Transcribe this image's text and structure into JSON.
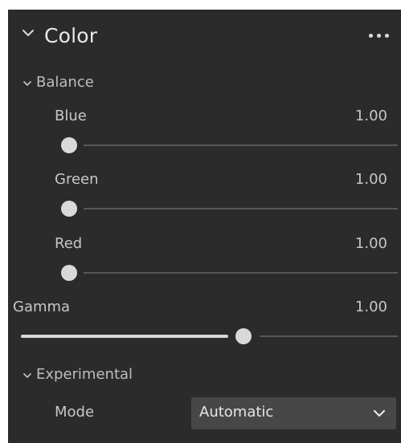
{
  "panel": {
    "title": "Color",
    "more_icon": "more-horizontal-icon"
  },
  "balance": {
    "label": "Balance",
    "sliders": [
      {
        "label": "Blue",
        "value": "1.00",
        "position": 0.0
      },
      {
        "label": "Green",
        "value": "1.00",
        "position": 0.0
      },
      {
        "label": "Red",
        "value": "1.00",
        "position": 0.0
      }
    ]
  },
  "gamma": {
    "label": "Gamma",
    "value": "1.00",
    "position": 0.59
  },
  "experimental": {
    "label": "Experimental",
    "mode_label": "Mode",
    "mode_value": "Automatic"
  },
  "colors": {
    "panel_bg": "#2b2b2b",
    "text": "#c7c7c7",
    "track": "#575757",
    "thumb": "#d9d9d9",
    "select_bg": "#474747"
  }
}
